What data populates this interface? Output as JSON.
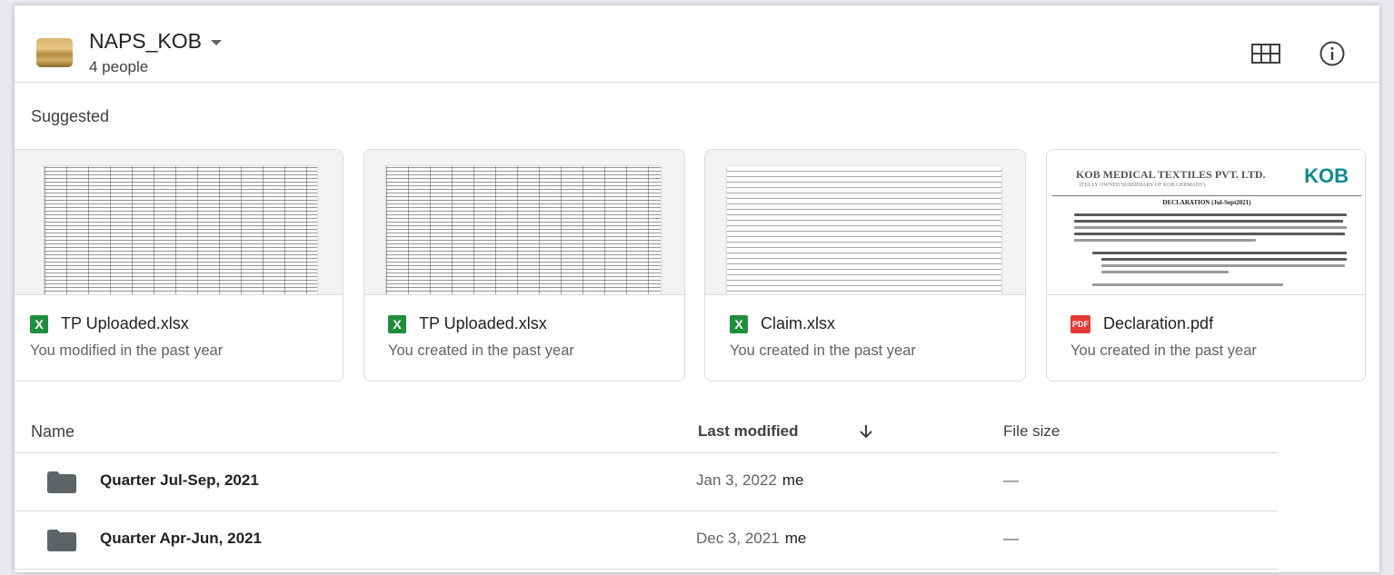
{
  "drive": {
    "name": "NAPS_KOB",
    "members": "4 people"
  },
  "toolbar": {
    "grid_icon": "grid-view-icon",
    "info_icon": "info-icon"
  },
  "suggested": {
    "label": "Suggested",
    "cards": [
      {
        "name": "TP Uploaded.xlsx",
        "subtitle": "You modified in the past year",
        "type": "xlsx",
        "badge": "X"
      },
      {
        "name": "TP Uploaded.xlsx",
        "subtitle": "You created in the past year",
        "type": "xlsx",
        "badge": "X"
      },
      {
        "name": "Claim.xlsx",
        "subtitle": "You created in the past year",
        "type": "xlsx",
        "badge": "X"
      },
      {
        "name": "Declaration.pdf",
        "subtitle": "You created in the past year",
        "type": "pdf",
        "badge": "PDF"
      }
    ],
    "declaration_preview": {
      "company": "KOB MEDICAL TEXTILES PVT. LTD.",
      "company_sub": "(FULLY OWNED SUBSIDIARY OF KOB GERMANY)",
      "logo": "KOB",
      "title": "DECLARATION (Jul-Sept2021)"
    }
  },
  "list": {
    "columns": {
      "name": "Name",
      "last_modified": "Last modified",
      "file_size": "File size"
    },
    "rows": [
      {
        "name": "Quarter Jul-Sep, 2021",
        "date": "Jan 3, 2022",
        "owner": "me",
        "size": "—"
      },
      {
        "name": "Quarter Apr-Jun, 2021",
        "date": "Dec 3, 2021",
        "owner": "me",
        "size": "—"
      }
    ]
  },
  "colors": {
    "accent_text": "#202124",
    "secondary_text": "#5f6368",
    "excel_green": "#1e8e3e",
    "pdf_red": "#e53935",
    "divider": "#dadce0"
  }
}
